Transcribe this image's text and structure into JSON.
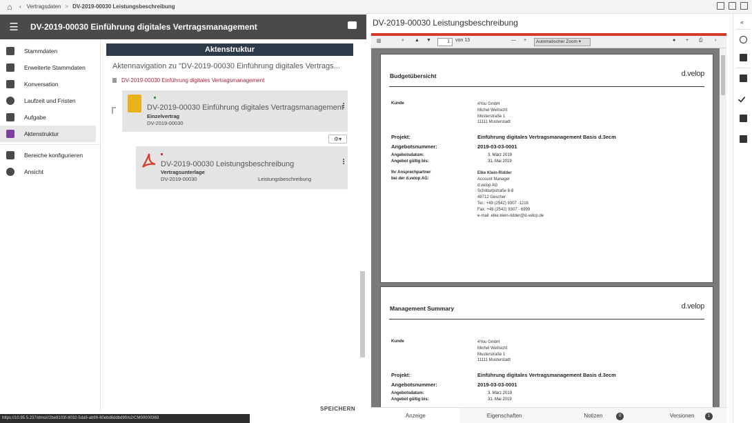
{
  "breadcrumb": {
    "items": [
      "Vertragsdaten",
      "DV-2019-00030 Leistungsbeschreibung"
    ],
    "separator": ">"
  },
  "left_header": {
    "title": "DV-2019-00030 Einführung digitales Vertragsmanagement"
  },
  "sidebar": {
    "items": [
      {
        "label": "Stammdaten",
        "icon": "document-icon"
      },
      {
        "label": "Erweiterte Stammdaten",
        "icon": "document-plus-icon"
      },
      {
        "label": "Konversation",
        "icon": "chat-icon"
      },
      {
        "label": "Laufzeit und Fristen",
        "icon": "clock-icon"
      },
      {
        "label": "Aufgabe",
        "icon": "calendar-icon"
      },
      {
        "label": "Aktenstruktur",
        "icon": "folder-icon",
        "active": true
      },
      {
        "label": "Bereiche konfigurieren",
        "icon": "list-icon"
      },
      {
        "label": "Ansicht",
        "icon": "gear-icon"
      }
    ]
  },
  "main": {
    "header": "Aktenstruktur",
    "nav_text": "Aktennavigation zu \"DV-2019-00030 Einführung digitales Vertrags...",
    "nav_link": "DV-2019-00030 Einführung digitales Vertragsmanagement",
    "parent_card": {
      "title": "DV-2019-00030 Einführung digitales Vertragsmanagement",
      "type": "Einzelvertrag",
      "number": "DV-2019-00030"
    },
    "child_card": {
      "title": "DV-2019-00030 Leistungsbeschreibung",
      "type": "Vertragsunterlage",
      "number": "DV-2019-00030",
      "category": "Leistungsbeschreibung"
    },
    "save_label": "SPEICHERN"
  },
  "status_url": "https://10.95.5.237/dms/r/2be9103f-8032-5da9-ab99-60ebd6ddbd90/o2/CM00000369",
  "viewer": {
    "title": "DV-2019-00030 Leistungsbeschreibung",
    "page_current": "1",
    "page_total": "von 13",
    "zoom": "Automatischer Zoom"
  },
  "pages": [
    {
      "heading": "Budgetübersicht",
      "logo": "d.velop",
      "kunde_label": "Kunde",
      "kunde_lines": [
        "4You GmbH",
        "Michel Weitsicht",
        "Musterstraße 1",
        "11111 Musterstadt"
      ],
      "projekt_label": "Projekt:",
      "projekt_value": "Einführung digitales Vertragsmanagement Basis d.3ecm",
      "angebot_label": "Angebotsnummer:",
      "angebot_value": "2019-03-03-0001",
      "datum_label": "Angebotsdatum:",
      "datum_value": "3. März 2019",
      "gueltig_label": "Angebot gültig bis:",
      "gueltig_value": "31. Mai 2019",
      "partner_label_1": "Ihr Ansprechpartner",
      "partner_label_2": "bei der d.velop AG:",
      "partner_lines": [
        "Elke Klein-Ridder",
        "Account Manager",
        "d.velop AG",
        "Schildarpstraße 6-8",
        "48712 Gescher",
        "Tel.:    +49 (2542) 9307 -1216",
        "Fax:    +49 (2542) 9307 - 6999",
        "e-mail: elke.klein-ridder@d-velop.de"
      ]
    },
    {
      "heading": "Management Summary",
      "logo": "d.velop",
      "kunde_label": "Kunde",
      "kunde_lines": [
        "4You GmbH",
        "Michel Weitsicht",
        "Musterstraße 1",
        "11111 Musterstadt"
      ],
      "projekt_label": "Projekt:",
      "projekt_value": "Einführung digitales Vertragsmanagement Basis d.3ecm",
      "angebot_label": "Angebotsnummer:",
      "angebot_value": "2019-03-03-0001",
      "datum_label": "Angebotsdatum:",
      "datum_value": "3. März 2019",
      "gueltig_label": "Angebot gültig bis:",
      "gueltig_value": "31. Mai 2019"
    }
  ],
  "tabs": [
    {
      "label": "Anzeige",
      "active": true
    },
    {
      "label": "Eigenschaften"
    },
    {
      "label": "Notizen",
      "count": "0"
    },
    {
      "label": "Versionen",
      "count": "1"
    }
  ],
  "colors": {
    "accent_red": "#d33a2a",
    "header_dark": "#4a4a4a",
    "active_nav": "#7a3fa0",
    "link_red": "#b0203a"
  }
}
